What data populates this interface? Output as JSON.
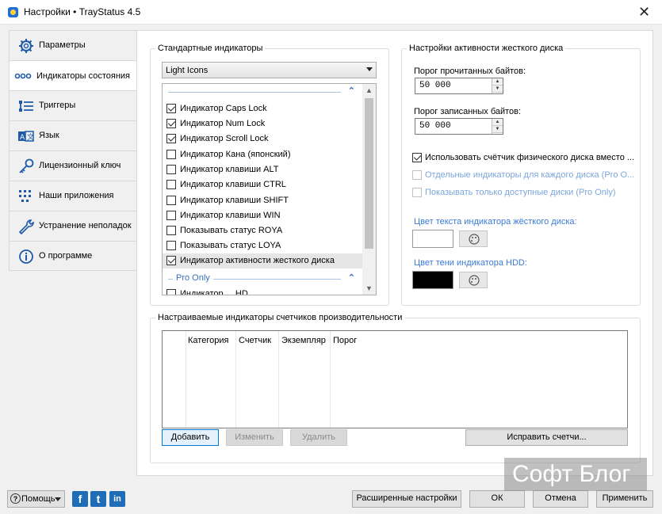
{
  "window": {
    "title": "Настройки • TrayStatus 4.5",
    "close_label": "✕"
  },
  "tabs": [
    {
      "label": "Параметры",
      "icon": "gear-icon"
    },
    {
      "label": "Индикаторы состояния",
      "icon": "dots-icon"
    },
    {
      "label": "Триггеры",
      "icon": "list-icon"
    },
    {
      "label": "Язык",
      "icon": "language-icon"
    },
    {
      "label": "Лицензионный ключ",
      "icon": "key-icon"
    },
    {
      "label": "Наши приложения",
      "icon": "apps-grid-icon"
    },
    {
      "label": "Устранение неполадок",
      "icon": "wrench-icon"
    },
    {
      "label": "О программе",
      "icon": "info-icon"
    }
  ],
  "active_tab": "Индикаторы состояния",
  "standard": {
    "legend": "Стандартные индикаторы",
    "theme_selected": "Light Icons",
    "items": [
      {
        "label": "Индикатор Caps Lock",
        "checked": true
      },
      {
        "label": "Индикатор Num Lock",
        "checked": true
      },
      {
        "label": "Индикатор Scroll Lock",
        "checked": true
      },
      {
        "label": "Индикатор Кана (японский)",
        "checked": false
      },
      {
        "label": "Индикатор клавиши ALT",
        "checked": false
      },
      {
        "label": "Индикатор клавиши CTRL",
        "checked": false
      },
      {
        "label": "Индикатор клавиши SHIFT",
        "checked": false
      },
      {
        "label": "Индикатор клавиши WIN",
        "checked": false
      },
      {
        "label": "Показывать статус ROYA",
        "checked": false
      },
      {
        "label": "Показывать статус LOYA",
        "checked": false
      },
      {
        "label": "Индикатор активности жесткого диска",
        "checked": true
      }
    ],
    "pro_group_label": "Pro Only",
    "pro_partial_item": "Индикатор ... HD"
  },
  "hdd": {
    "legend": "Настройки активности жесткого диска",
    "read_label": "Порог прочитанных байтов:",
    "read_value": "50 000",
    "write_label": "Порог записанных байтов:",
    "write_value": "50 000",
    "use_physical_label": "Использовать счётчик физического диска вместо ...",
    "separate_label": "Отдельные индикаторы для каждого диска (Pro O...",
    "only_available_label": "Показывать только доступные диски (Pro Only)",
    "text_color_label": "Цвет текста индикатора жёсткого диска:",
    "text_color": "#ffffff",
    "shadow_color_label": "Цвет тени индикатора HDD:",
    "shadow_color": "#000000"
  },
  "perf": {
    "legend": "Настраиваемые индикаторы счетчиков производительности",
    "columns": [
      "Категория",
      "Счетчик",
      "Экземпляр",
      "Порог"
    ],
    "add": "Добавить",
    "edit": "Изменить",
    "delete": "Удалить",
    "fix": "Исправить счетчи..."
  },
  "footer": {
    "help": "Помощь",
    "advanced": "Расширенные настройки",
    "ok": "ОК",
    "cancel": "Отмена",
    "apply": "Применить",
    "social": [
      "f",
      "t",
      "in"
    ]
  },
  "watermark": "Софт Блог"
}
